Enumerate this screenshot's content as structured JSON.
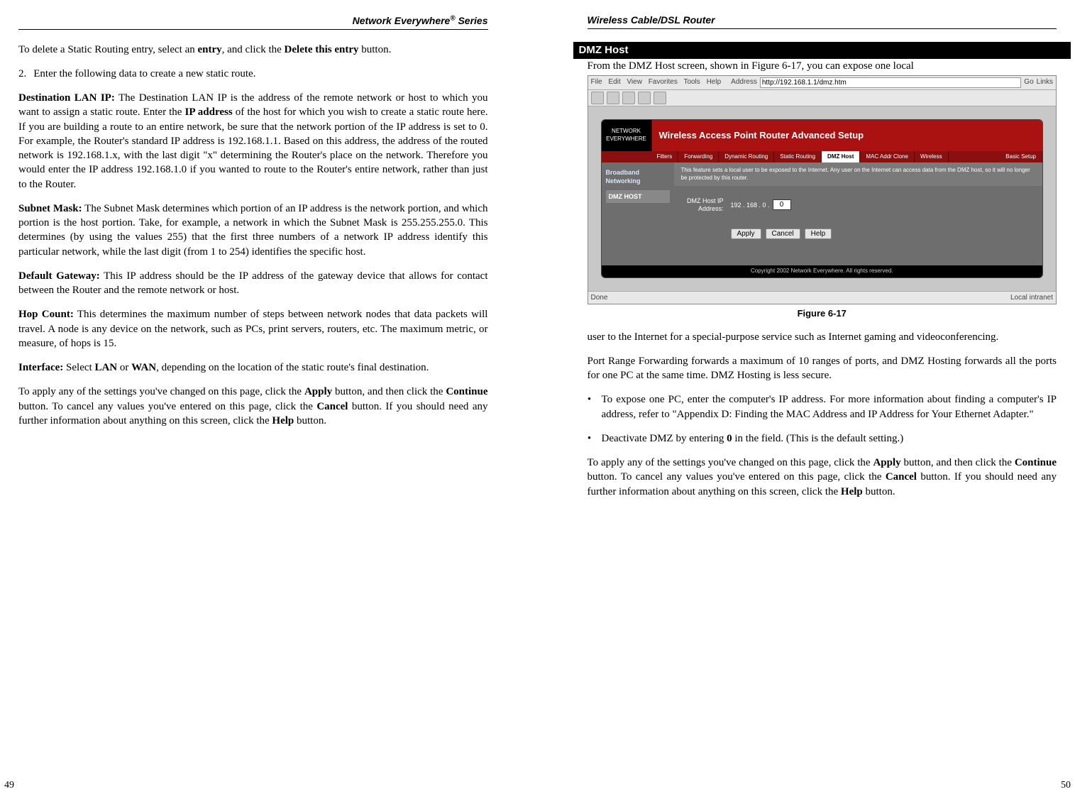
{
  "left": {
    "header": "Network Everywhere® Series",
    "page_num": "49",
    "p0a": "To delete a Static Routing entry, select an ",
    "p0b": "entry",
    "p0c": ", and click the ",
    "p0d": "Delete this entry",
    "p0e": " button.",
    "num2": "2.",
    "p1": "Enter the following data to create a new static route.",
    "dli_label": "Destination LAN IP:",
    "dli_a": "  The Destination LAN IP is the address of the remote network or host to which you want to assign a static route. Enter the ",
    "dli_b": "IP address",
    "dli_c": " of the host for which you wish to create a static route here. If you are building a route to an entire network, be sure that the network portion of the IP address is set to 0. For example, the Router's standard IP address is 192.168.1.1. Based on this address, the address of the routed network is 192.168.1.x, with the last digit \"x\" determining the Router's place on the network. Therefore you would enter the IP address 192.168.1.0 if you wanted to route to the Router's entire network, rather than just to the Router.",
    "sm_label": "Subnet Mask:",
    "sm_body": "   The Subnet Mask determines which portion of an IP address is the network portion, and which portion is the host portion. Take, for example, a network in which the Subnet Mask is 255.255.255.0. This determines (by using the values 255) that the first three numbers of a network IP address identify this particular network, while the last digit (from 1 to 254) identifies the specific host.",
    "dg_label": "Default Gateway:",
    "dg_body": "  This IP address should be the IP address of the gateway device that allows for contact between the Router and the remote network or host.",
    "hc_label": "Hop Count:",
    "hc_body": " This determines the maximum number of steps between network nodes that data packets will travel. A node is any device on the network, such as PCs, print servers, routers, etc. The maximum metric, or measure, of hops is 15.",
    "if_label": "Interface:",
    "if_a": " Select ",
    "if_b": "LAN",
    "if_c": " or ",
    "if_d": "WAN",
    "if_e": ", depending on the location of the static route's final destination.",
    "apply_a": "To apply any of the settings you've changed on this page, click the ",
    "apply_b": "Apply",
    "apply_c": " button, and then click the ",
    "apply_d": "Continue",
    "apply_e": " button.  To cancel any values you've entered on this page, click the ",
    "apply_f": "Cancel",
    "apply_g": " button. If you should need any further information about anything on this screen, click the ",
    "apply_h": "Help",
    "apply_i": " button."
  },
  "right": {
    "header": "Wireless Cable/DSL Router",
    "page_num": "50",
    "section": "DMZ Host",
    "intro": "From the DMZ Host screen, shown in Figure 6-17, you can expose one local",
    "caption": "Figure 6-17",
    "p1": "user to the Internet for a special-purpose service such as Internet gaming and videoconferencing.",
    "p2": "Port Range Forwarding forwards a maximum of 10 ranges of ports, and DMZ Hosting forwards all the ports for one PC at the same time. DMZ Hosting is less secure.",
    "b1": "To expose one PC, enter the computer's IP address. For more information about finding a computer's IP address, refer to \"Appendix D: Finding the MAC Address and IP Address for Your Ethernet Adapter.\"",
    "b2a": "Deactivate DMZ by entering ",
    "b2b": "0",
    "b2c": " in the field. (This is the default setting.)",
    "apply_a": "To apply any of the settings you've changed on this page, click the ",
    "apply_b": "Apply",
    "apply_c": " button, and then click the ",
    "apply_d": "Continue",
    "apply_e": " button.  To cancel any values you've entered on this page, click the ",
    "apply_f": "Cancel",
    "apply_g": " button. If you should need any further information about anything on this screen, click the ",
    "apply_h": "Help",
    "apply_i": " button."
  },
  "shot": {
    "menu": [
      "File",
      "Edit",
      "View",
      "Favorites",
      "Tools",
      "Help"
    ],
    "addr_label": "Address",
    "url": "http://192.168.1.1/dmz.htm",
    "go": "Go",
    "links": "Links",
    "banner_title": "Wireless Access Point Router Advanced Setup",
    "logo": "NETWORK EVERYWHERE",
    "tabs": [
      "Filters",
      "Forwarding",
      "Dynamic Routing",
      "Static Routing",
      "DMZ Host",
      "MAC Addr Clone",
      "Wireless",
      "Basic Setup"
    ],
    "left_cat": "Broadband Networking",
    "left_sel": "DMZ HOST",
    "desc": "This feature sets a local user to be exposed to the Internet. Any user on the Internet can access data from the DMZ host, so it will no longer be protected by this router.",
    "form_label": "DMZ Host IP Address:",
    "ip_prefix": "192 . 168 . 0 .",
    "ip_value": "0",
    "btn_apply": "Apply",
    "btn_cancel": "Cancel",
    "btn_help": "Help",
    "copyright": "Copyright 2002 Network Everywhere. All rights reserved.",
    "status_done": "Done",
    "status_zone": "Local intranet"
  }
}
